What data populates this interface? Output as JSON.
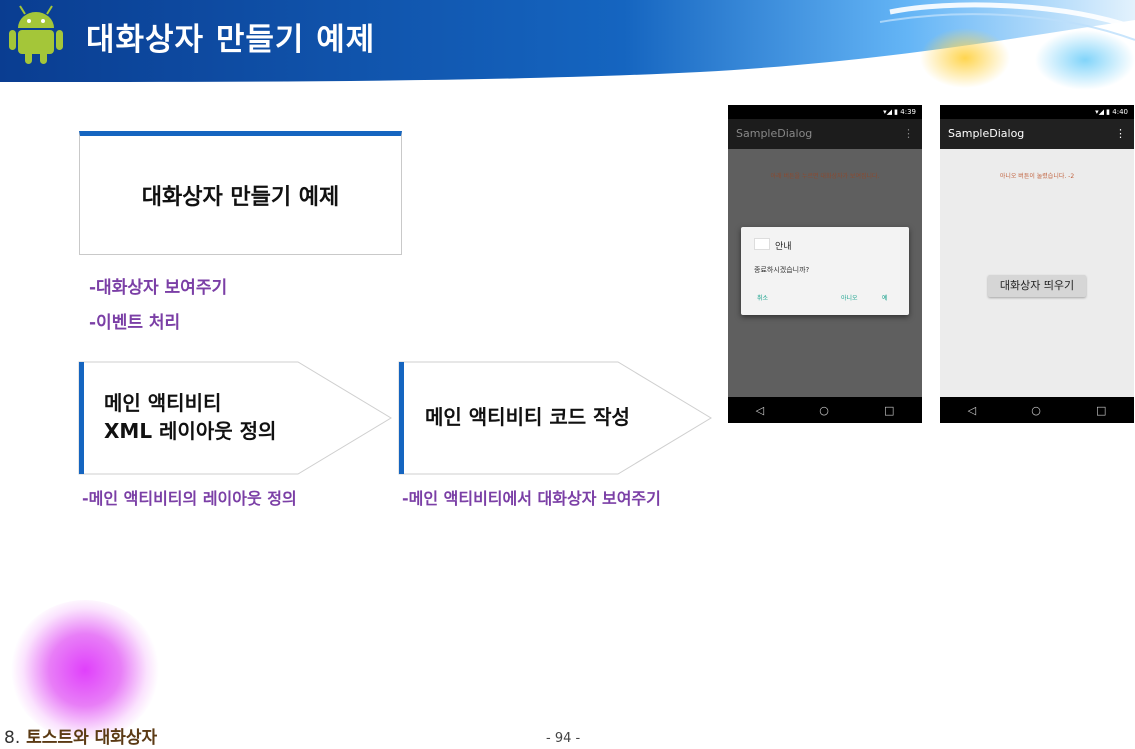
{
  "slide": {
    "title": "대화상자 만들기 예제"
  },
  "title_box": {
    "text": "대화상자 만들기 예제"
  },
  "bullets": [
    "-대화상자 보여주기",
    "-이벤트 처리"
  ],
  "steps": [
    {
      "line1": "메인 액티비티",
      "line2": "XML 레이아웃 정의",
      "caption": "-메인 액티비티의 레이아웃 정의"
    },
    {
      "line1": "메인 액티비티 코드 작성",
      "line2": "",
      "caption": "-메인 액티비티에서 대화상자 보여주기"
    }
  ],
  "phone_left": {
    "status": "4:39",
    "app_title": "SampleDialog",
    "message": "아래 버튼을 누르면 대화상자가 보여집니다.",
    "dialog": {
      "title": "안내",
      "message": "종료하시겠습니까?",
      "buttons": [
        "취소",
        "아니오",
        "예"
      ]
    }
  },
  "phone_right": {
    "status": "4:40",
    "app_title": "SampleDialog",
    "message": "아니오 버튼이 눌렸습니다. -2",
    "button_label": "대화상자 띄우기"
  },
  "nav_icons": [
    "back-icon",
    "home-icon",
    "recents-icon"
  ],
  "footer": {
    "section_number": "8.",
    "section_title": "토스트와 대화상자",
    "page": "- 94 -"
  },
  "colors": {
    "header_blue": "#0d47a1",
    "accent_blue": "#1565c0",
    "bullet_purple": "#7b3fa6",
    "footer_brown": "#5b3a14"
  }
}
